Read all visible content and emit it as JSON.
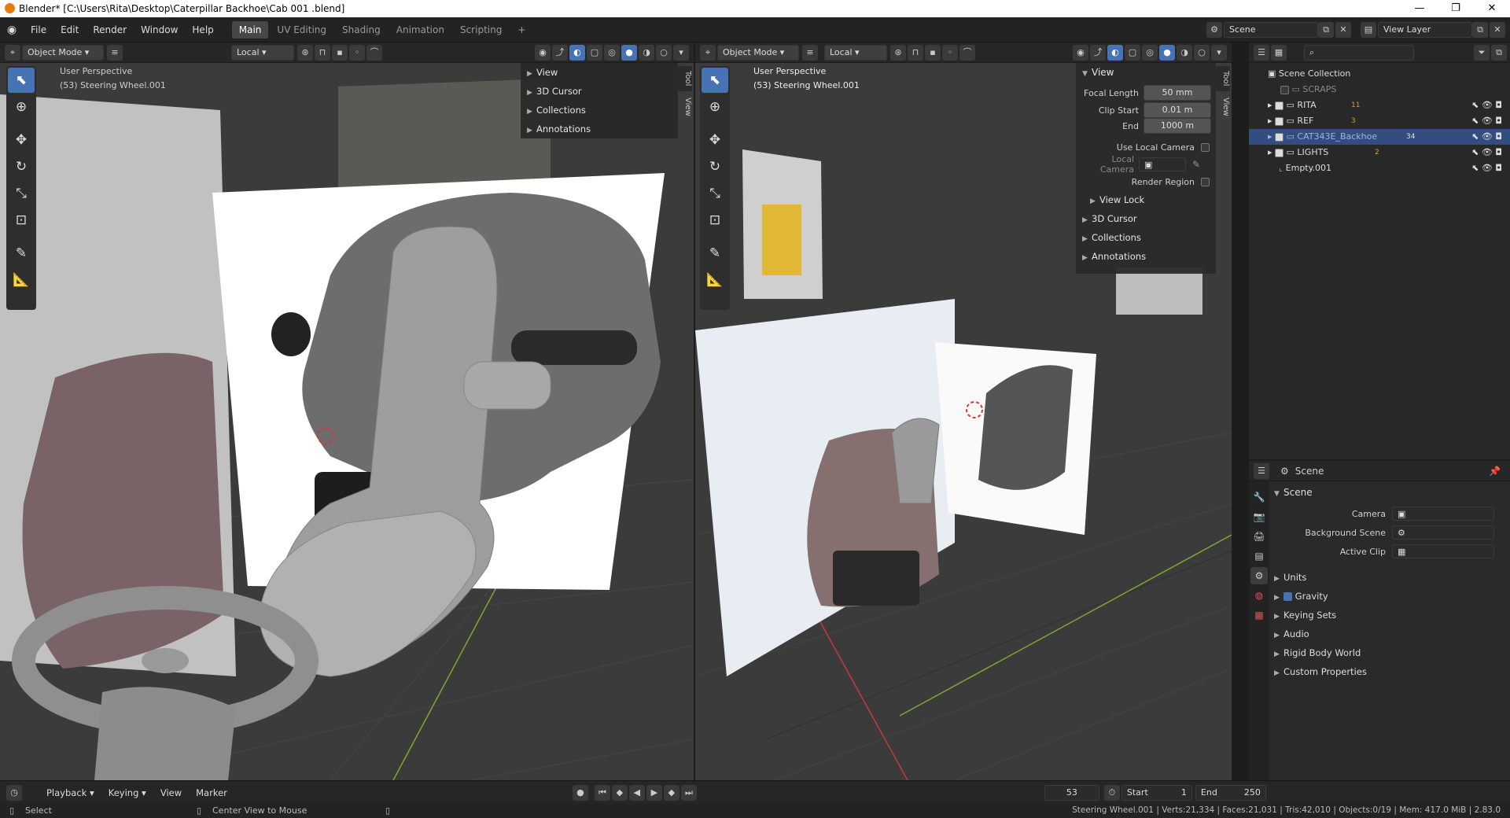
{
  "titlebar": {
    "title": "Blender* [C:\\Users\\Rita\\Desktop\\Caterpillar Backhoe\\Cab 001 .blend]",
    "minimize": "—",
    "maximize": "❐",
    "close": "✕"
  },
  "menu": [
    "File",
    "Edit",
    "Render",
    "Window",
    "Help"
  ],
  "workspaces": [
    "Main",
    "UV Editing",
    "Shading",
    "Animation",
    "Scripting"
  ],
  "add_workspace": "+",
  "scene_field": "Scene",
  "view_layer_field": "View Layer",
  "viewport_left": {
    "mode": "Object Mode",
    "orientation": "Local",
    "overlay_line1": "User Perspective",
    "overlay_line2": "(53) Steering Wheel.001",
    "panel_items": [
      "View",
      "3D Cursor",
      "Collections",
      "Annotations"
    ],
    "tabs": [
      "Tool",
      "View"
    ]
  },
  "viewport_right": {
    "mode": "Object Mode",
    "orientation": "Local",
    "overlay_line1": "User Perspective",
    "overlay_line2": "(53) Steering Wheel.001",
    "tabs": [
      "Tool",
      "View"
    ],
    "panel": {
      "header": "View",
      "focal_length_label": "Focal Length",
      "focal_length_value": "50 mm",
      "clip_start_label": "Clip Start",
      "clip_start_value": "0.01 m",
      "end_label": "End",
      "end_value": "1000 m",
      "use_local_camera": "Use Local Camera",
      "local_camera": "Local Camera",
      "render_region": "Render Region",
      "view_lock": "View Lock",
      "sections": [
        "3D Cursor",
        "Collections",
        "Annotations"
      ]
    }
  },
  "outliner": {
    "root": "Scene Collection",
    "items": [
      {
        "name": "SCRAPS",
        "checked": false,
        "selected": false
      },
      {
        "name": "RITA",
        "checked": true,
        "selected": false,
        "badge": "11"
      },
      {
        "name": "REF",
        "checked": true,
        "selected": false,
        "badge": "3"
      },
      {
        "name": "CAT343E_Backhoe",
        "checked": true,
        "selected": true,
        "badge": "34"
      },
      {
        "name": "LIGHTS",
        "checked": true,
        "selected": false,
        "badge": "2"
      }
    ],
    "empty": "Empty.001"
  },
  "properties": {
    "header": "Scene",
    "section": "Scene",
    "camera_label": "Camera",
    "background_scene_label": "Background Scene",
    "active_clip_label": "Active Clip",
    "sections": [
      "Units",
      "Gravity",
      "Keying Sets",
      "Audio",
      "Rigid Body World",
      "Custom Properties"
    ]
  },
  "timeline": {
    "menus": [
      "Playback",
      "Keying",
      "View",
      "Marker"
    ],
    "current_frame": "53",
    "start_label": "Start",
    "start_value": "1",
    "end_label": "End",
    "end_value": "250"
  },
  "status": {
    "left_action": "Select",
    "mid_action": "Center View to Mouse",
    "stats": "Steering Wheel.001 | Verts:21,334 | Faces:21,031 | Tris:42,010 | Objects:0/19 | Mem: 417.0 MiB | 2.83.0"
  },
  "colors": {
    "accent": "#4772b3",
    "selection": "#334d80",
    "viewport_bg": "#3b3b3b",
    "x_axis": "#c43a3a",
    "y_axis": "#7aaa2e"
  }
}
